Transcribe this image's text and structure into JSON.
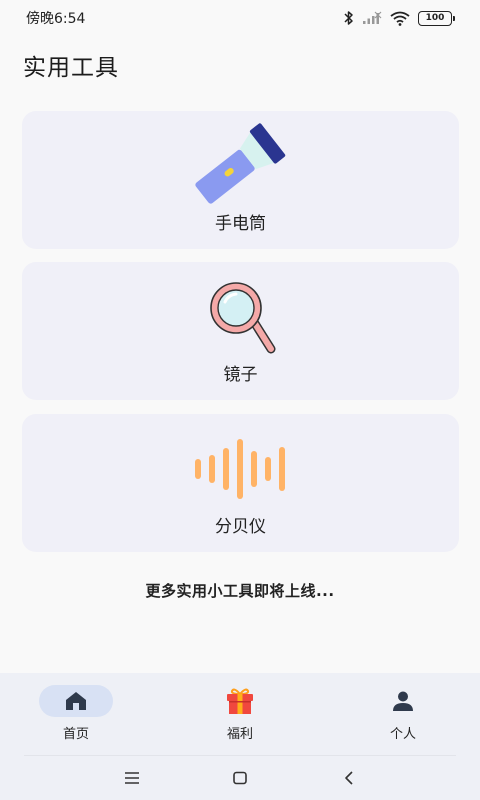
{
  "status_bar": {
    "time": "傍晚6:54",
    "battery": "100"
  },
  "page": {
    "title": "实用工具"
  },
  "tools": [
    {
      "label": "手电筒",
      "icon": "flashlight-icon"
    },
    {
      "label": "镜子",
      "icon": "magnifier-mirror-icon"
    },
    {
      "label": "分贝仪",
      "icon": "sound-wave-icon"
    }
  ],
  "footer_tip": "更多实用小工具即将上线...",
  "bottom_nav": {
    "active": "home",
    "items": [
      {
        "key": "home",
        "label": "首页",
        "icon": "home-icon"
      },
      {
        "key": "welfare",
        "label": "福利",
        "icon": "gift-icon"
      },
      {
        "key": "profile",
        "label": "个人",
        "icon": "person-icon"
      }
    ]
  },
  "system_nav": [
    "menu-icon",
    "home-square-icon",
    "back-icon"
  ],
  "colors": {
    "background": "#f9f9f9",
    "card": "#f0f0f8",
    "flashlight_body": "#8a9af0",
    "flashlight_head": "#2a3590",
    "mirror": "#f4a9a8",
    "decibel": "#ffb366",
    "nav_active": "#d8e1f4",
    "gift": "#f0483e"
  }
}
